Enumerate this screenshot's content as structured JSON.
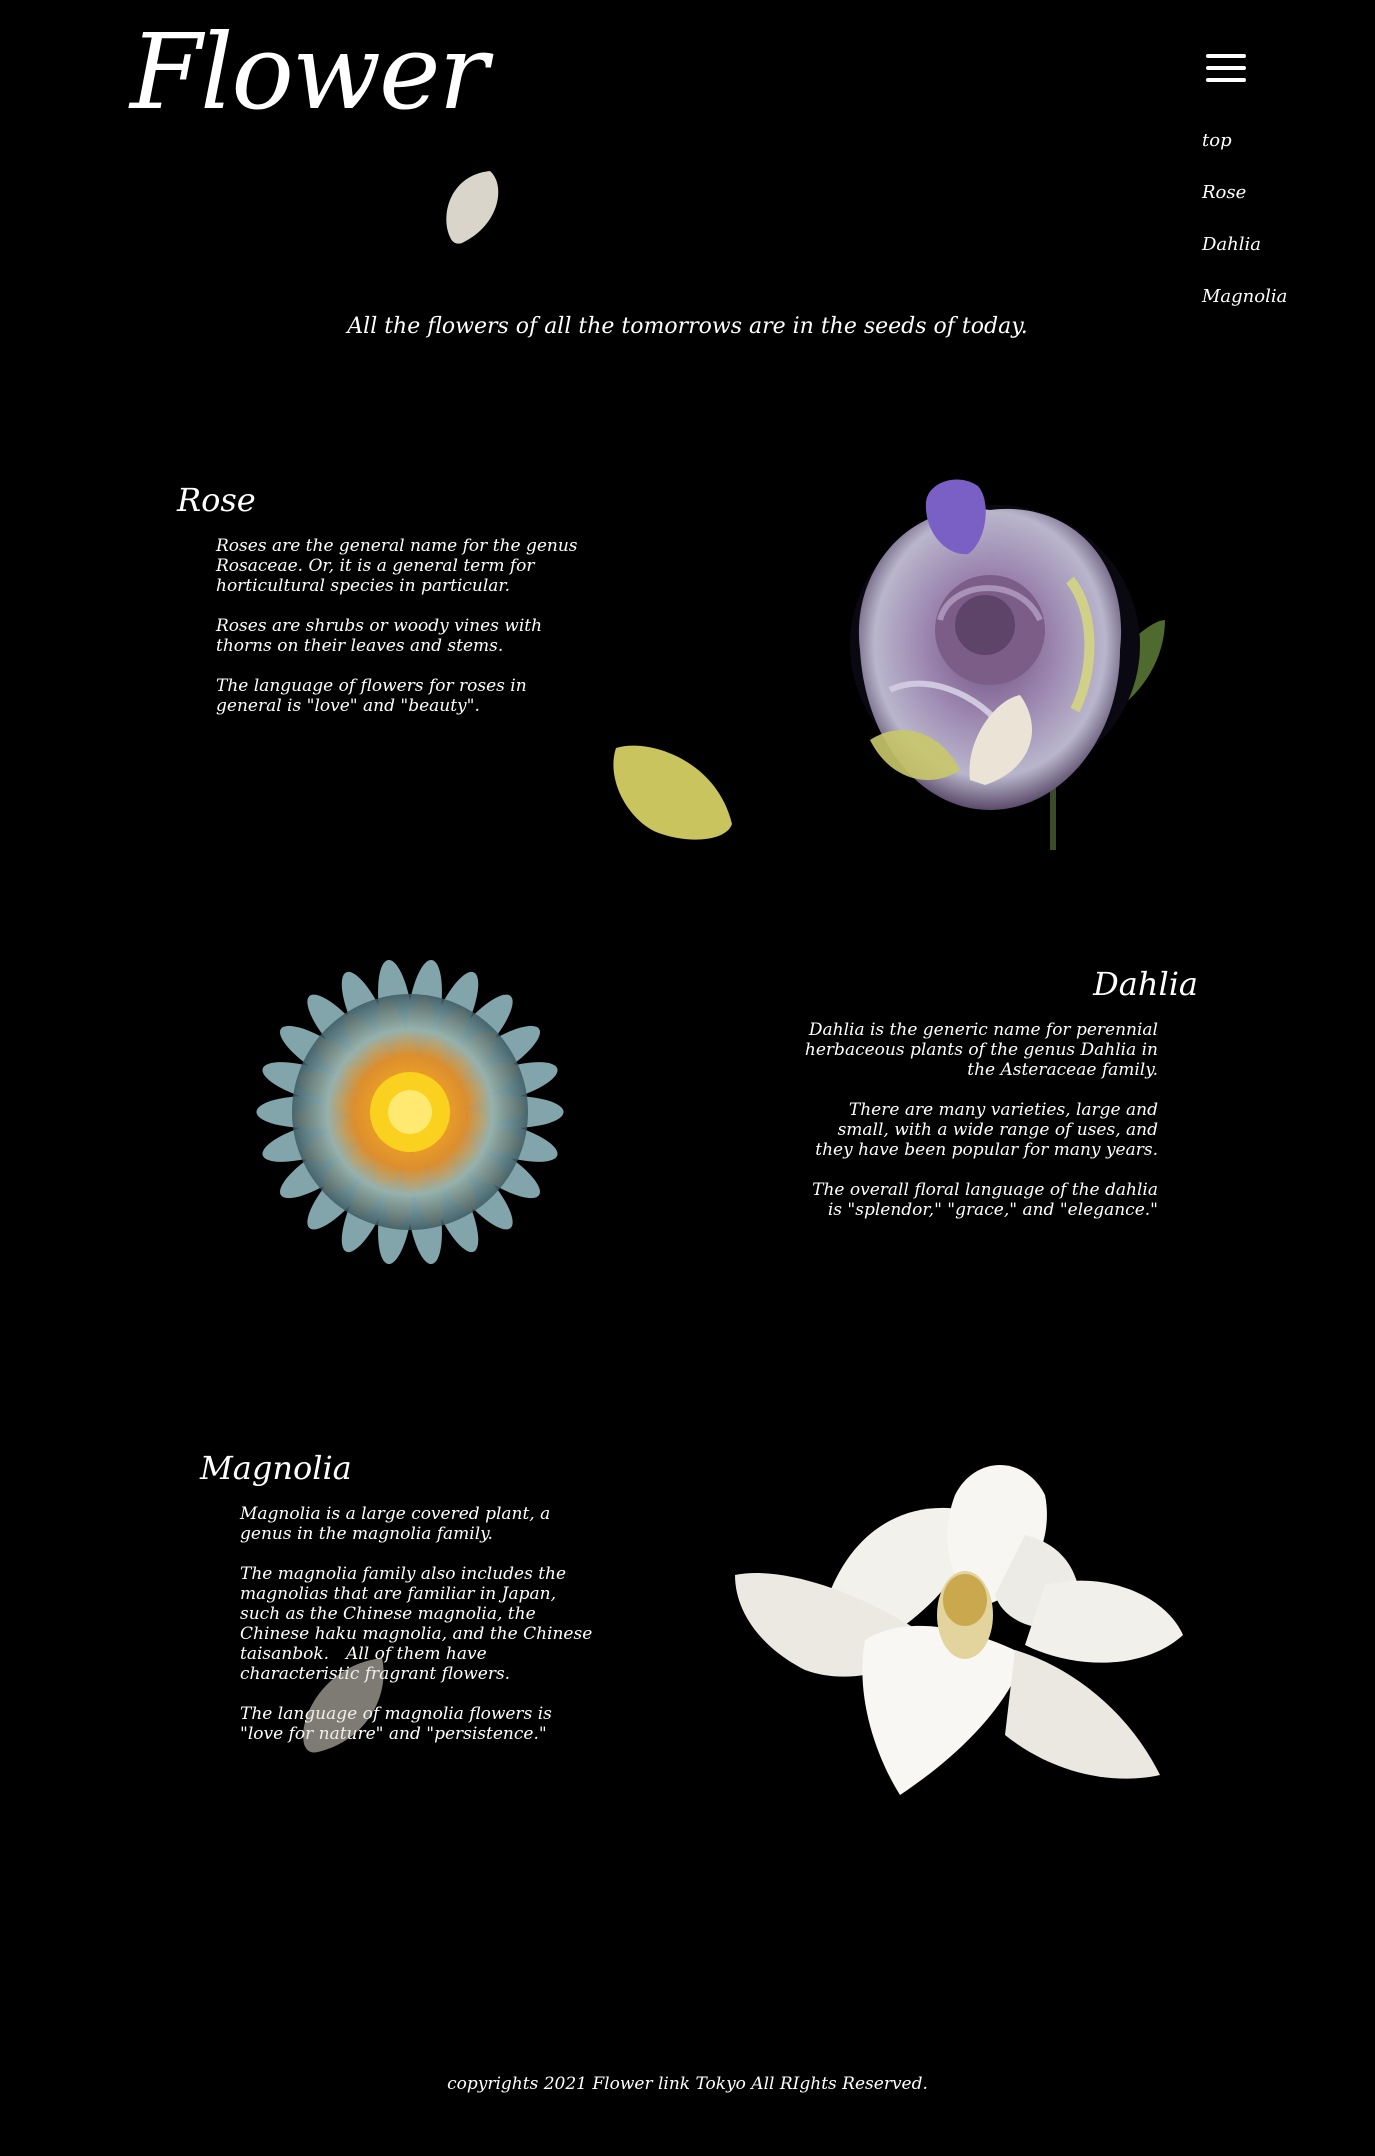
{
  "header": {
    "logo": "Flower",
    "menu_icon": "hamburger-icon",
    "nav": [
      "top",
      "Rose",
      "Dahlia",
      "Magnolia"
    ]
  },
  "hero": {
    "tagline": "All the flowers of all the tomorrows are in the seeds of today."
  },
  "sections": {
    "rose": {
      "title": "Rose",
      "paragraphs": [
        "Roses are the general name for the genus Rosaceae. Or, it is a general term for horticultural species in particular.",
        "Roses are shrubs or woody vines with thorns on their leaves and stems.",
        "The language of flowers for roses in general is \"love\" and \"beauty\"."
      ]
    },
    "dahlia": {
      "title": "Dahlia",
      "paragraphs": [
        "Dahlia is the generic name for perennial herbaceous plants of the genus Dahlia in the Asteraceae family.",
        "There are many varieties, large and small, with a wide range of uses, and they have been popular for many years.",
        "The overall floral language of the dahlia is \"splendor,\" \"grace,\" and \"elegance.\""
      ]
    },
    "magnolia": {
      "title": "Magnolia",
      "paragraphs": [
        "Magnolia is a large covered plant, a genus in the magnolia family.",
        "The magnolia family also includes the magnolias that are familiar in Japan, such as the Chinese magnolia, the Chinese haku magnolia, and the Chinese taisanbok.　All of them have characteristic fragrant flowers.",
        "The language of magnolia flowers is \"love for nature\" and \"persistence.\""
      ]
    }
  },
  "footer": {
    "copyright": "copyrights 2021 Flower link Tokyo All RIghts Reserved."
  },
  "colors": {
    "background": "#000000",
    "text": "#ffffff",
    "petal_cream": "#e6e0d6",
    "petal_yellow": "#d8d36a",
    "petal_purple": "#7a5fc4",
    "dahlia_orange": "#f5a623"
  }
}
